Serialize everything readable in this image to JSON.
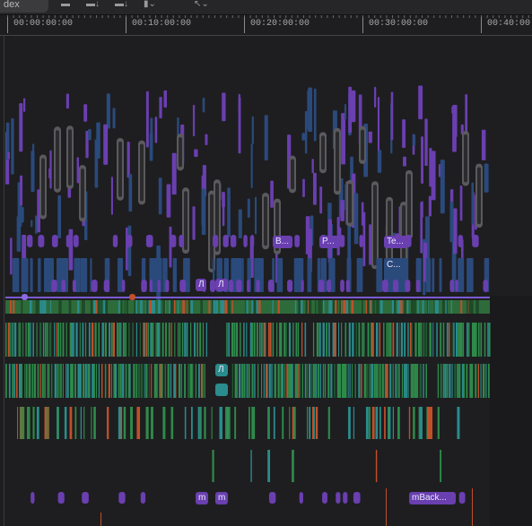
{
  "toolbar": {
    "index_label": "dex",
    "icons": [
      "clip-appearance-icon",
      "append-icon",
      "overwrite-icon",
      "connect-icon",
      "select-tool-icon"
    ]
  },
  "ruler": {
    "timecodes": [
      "00:00:00:00",
      "00:10:00:00",
      "00:20:00:00",
      "00:30:00:00",
      "00:40:00"
    ]
  },
  "clips": {
    "purple_labels": [
      "B...",
      "P...",
      "Te...",
      "m",
      "m",
      "mBack..."
    ],
    "blue_labels": [
      "C..."
    ],
    "teal_labels": [
      "Л",
      "Л",
      "Л"
    ]
  },
  "colors": {
    "background": "#1e1e20",
    "purple": "#6a3fb0",
    "blue": "#2b4a7c",
    "green": "#2e6b3a",
    "teal": "#2a8c8c",
    "orange": "#c0502a"
  }
}
